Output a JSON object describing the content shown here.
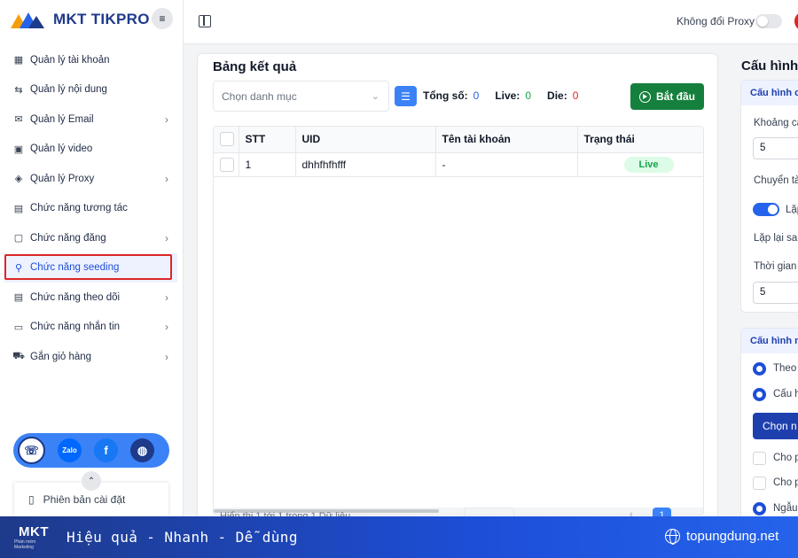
{
  "app": {
    "logo_text": "MKT TIKPRO"
  },
  "sidebar": {
    "items": [
      {
        "label": "Quản lý tài khoản",
        "icon": "dashboard-icon",
        "has_submenu": false
      },
      {
        "label": "Quản lý nội dung",
        "icon": "content-icon",
        "has_submenu": false
      },
      {
        "label": "Quản lý Email",
        "icon": "email-icon",
        "has_submenu": true
      },
      {
        "label": "Quản lý video",
        "icon": "video-icon",
        "has_submenu": false
      },
      {
        "label": "Quản lý Proxy",
        "icon": "proxy-icon",
        "has_submenu": true
      },
      {
        "label": "Chức năng tương tác",
        "icon": "interaction-icon",
        "has_submenu": false
      },
      {
        "label": "Chức năng đăng",
        "icon": "post-icon",
        "has_submenu": true
      },
      {
        "label": "Chức năng seeding",
        "icon": "seeding-icon",
        "has_submenu": false,
        "active": true
      },
      {
        "label": "Chức năng theo dõi",
        "icon": "follow-icon",
        "has_submenu": true
      },
      {
        "label": "Chức năng nhắn tin",
        "icon": "message-icon",
        "has_submenu": true
      },
      {
        "label": "Gắn giỏ hàng",
        "icon": "cart-icon",
        "has_submenu": true
      }
    ],
    "social": {
      "zalo_label": "Zalo"
    },
    "version_label": "Phiên bản cài đặt"
  },
  "topbar": {
    "proxy_label": "Không đổi Proxy",
    "proxy_enabled": false
  },
  "results": {
    "title": "Bảng kết quả",
    "category_placeholder": "Chọn danh mục",
    "stats": {
      "total_label": "Tổng số:",
      "total": "0",
      "live_label": "Live:",
      "live": "0",
      "die_label": "Die:",
      "die": "0"
    },
    "start_button": "Bắt đầu",
    "columns": [
      "STT",
      "UID",
      "Tên tài khoản",
      "Trạng thái"
    ],
    "rows": [
      {
        "stt": "1",
        "uid": "dhhfhfhfff",
        "name": "-",
        "status": "Live"
      }
    ],
    "footer_text": "Hiển thị 1 tới 1 trong 1 Dữ liệu",
    "current_page": "1"
  },
  "config": {
    "title": "Cấu hình",
    "section1_head": "Cấu hình c",
    "delay_label": "Khoảng cá",
    "delay_value": "5",
    "switch_label": "Chuyển tà",
    "repeat_toggle_label": "Lặp",
    "repeat_after_label": "Lặp lại sau",
    "time_label": "Thời gian g",
    "time_value": "5",
    "section2_head": "Cấu hình n",
    "radio1_label": "Theo",
    "radio2_label": "Cấu h",
    "choose_button": "Chọn n",
    "check1_label": "Cho p",
    "check2_label": "Cho p",
    "radio3_label": "Ngẫu"
  },
  "banner": {
    "logo_text": "MKT",
    "logo_sub": "Phần mềm Marketing",
    "tagline": "Hiệu quả - Nhanh  - Dễ dùng",
    "site": "topungdung.net"
  },
  "colors": {
    "primary": "#3b82f6",
    "navy": "#1e3a8a",
    "start_green": "#15803d",
    "live_green": "#16a34a",
    "die_red": "#dc2626",
    "active_outline": "#dc2626"
  }
}
